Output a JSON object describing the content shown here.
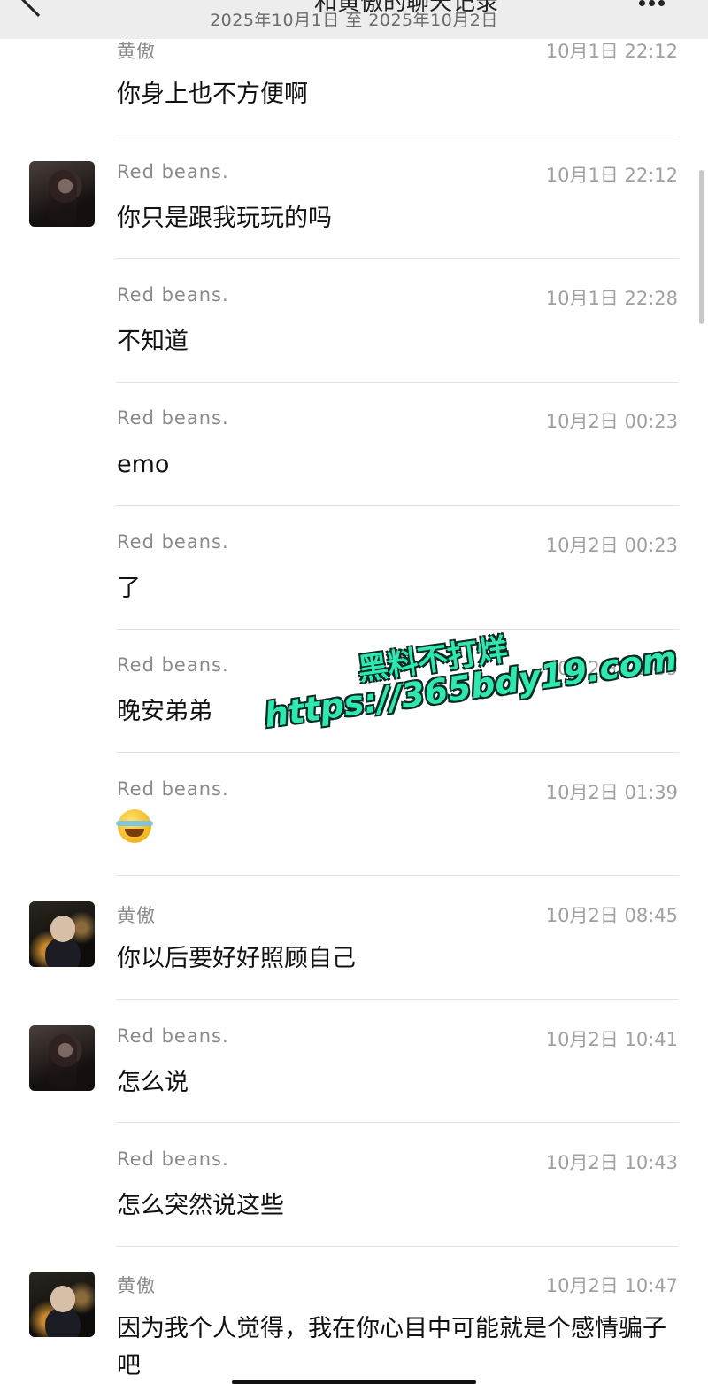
{
  "header": {
    "title": "和黄傲的聊天记录",
    "date_range": "2025年10月1日 至 2025年10月2日"
  },
  "messages": [
    {
      "sender": "黄傲",
      "time": "10月1日 22:12",
      "text": "你身上也不方便啊"
    },
    {
      "sender": "Red  beans.",
      "time": "10月1日 22:12",
      "text": "你只是跟我玩玩的吗"
    },
    {
      "sender": "Red  beans.",
      "time": "10月1日 22:28",
      "text": "不知道"
    },
    {
      "sender": "Red  beans.",
      "time": "10月2日 00:23",
      "text": "emo"
    },
    {
      "sender": "Red  beans.",
      "time": "10月2日 00:23",
      "text": "了"
    },
    {
      "sender": "Red  beans.",
      "time": "10月2日 01:39",
      "text": "晚安弟弟"
    },
    {
      "sender": "Red  beans.",
      "time": "10月2日 01:39",
      "emoji": "loudly-crying-face-icon"
    },
    {
      "sender": "黄傲",
      "time": "10月2日 08:45",
      "text": "你以后要好好照顾自己"
    },
    {
      "sender": "Red  beans.",
      "time": "10月2日 10:41",
      "text": "怎么说"
    },
    {
      "sender": "Red  beans.",
      "time": "10月2日 10:43",
      "text": "怎么突然说这些"
    },
    {
      "sender": "黄傲",
      "time": "10月2日 10:47",
      "text": "因为我个人觉得，我在你心目中可能就是个感情骗子吧"
    }
  ],
  "watermark": {
    "line1": "黑料不打烊",
    "line2": "https://365bdy19.com",
    "color": "#2ee8b0"
  },
  "colors": {
    "header_bg": "#ededed",
    "name_text": "#8a8a8a",
    "time_text": "#a0a0a0",
    "divider": "#e3e3e3"
  }
}
